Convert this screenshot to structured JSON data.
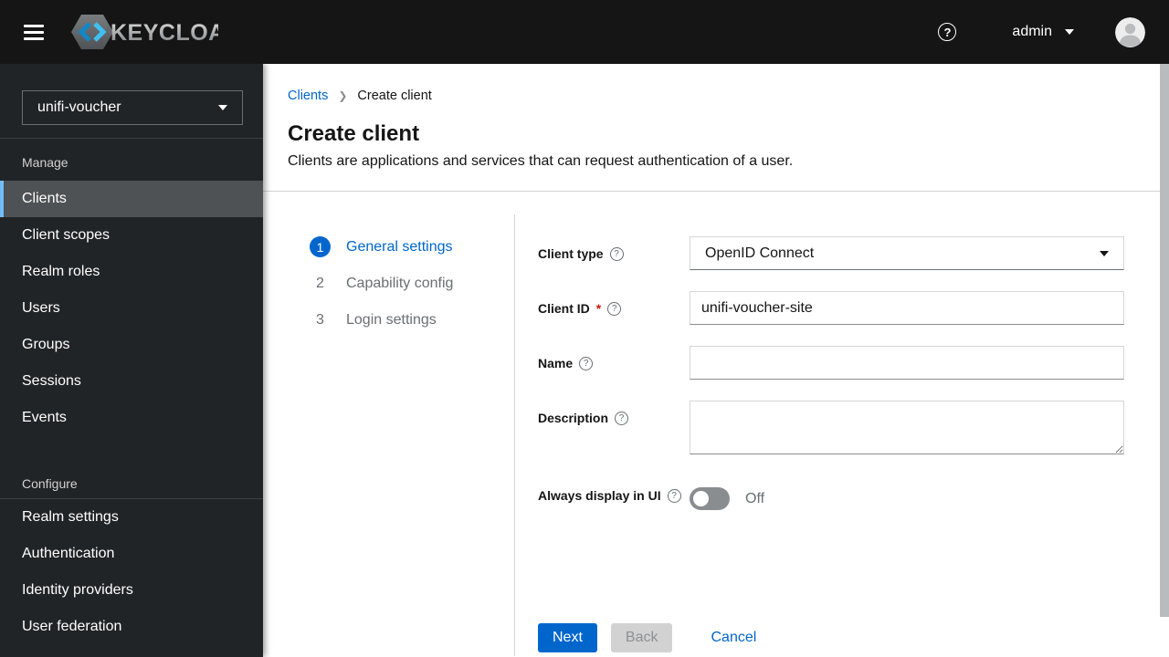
{
  "masthead": {
    "brand": "KEYCLOAK",
    "username": "admin"
  },
  "icons": {
    "help_glyph": "?",
    "breadcrumb_separator": "❯"
  },
  "sidebar": {
    "realm": "unifi-voucher",
    "sections": [
      {
        "label": "Manage",
        "items": [
          "Clients",
          "Client scopes",
          "Realm roles",
          "Users",
          "Groups",
          "Sessions",
          "Events"
        ],
        "active_item": "Clients"
      },
      {
        "label": "Configure",
        "items": [
          "Realm settings",
          "Authentication",
          "Identity providers",
          "User federation"
        ]
      }
    ]
  },
  "breadcrumb": {
    "items": [
      "Clients",
      "Create client"
    ]
  },
  "page": {
    "title": "Create client",
    "subtitle": "Clients are applications and services that can request authentication of a user."
  },
  "wizard": {
    "steps": [
      {
        "number": "1",
        "label": "General settings",
        "active": true
      },
      {
        "number": "2",
        "label": "Capability config",
        "active": false
      },
      {
        "number": "3",
        "label": "Login settings",
        "active": false
      }
    ]
  },
  "form": {
    "fields": [
      {
        "label": "Client type",
        "type": "select",
        "value": "OpenID Connect",
        "required": false
      },
      {
        "label": "Client ID",
        "type": "text",
        "value": "unifi-voucher-site",
        "required": true
      },
      {
        "label": "Name",
        "type": "text",
        "value": "",
        "required": false
      },
      {
        "label": "Description",
        "type": "textarea",
        "value": "",
        "required": false
      },
      {
        "label": "Always display in UI",
        "type": "toggle",
        "state": "Off",
        "required": false
      }
    ],
    "required_marker": "*"
  },
  "actions": {
    "next": "Next",
    "back": "Back",
    "cancel": "Cancel"
  },
  "colors": {
    "masthead_bg": "#151515",
    "sidebar_bg": "#212427",
    "active_nav_bg": "#4f5255",
    "active_nav_border": "#73bcf7",
    "primary_blue": "#0066cc",
    "link_blue": "#0066cc",
    "muted_text": "#6a6e73",
    "required_red": "#c9190b",
    "disabled_bg": "#d2d2d2",
    "divider": "#d2d2d2",
    "sidebar_divider": "#3c3f42",
    "toggle_off_bg": "#8a8d90",
    "logo_blue_dark": "#1287c5",
    "logo_blue_light": "#3fc0f0"
  }
}
